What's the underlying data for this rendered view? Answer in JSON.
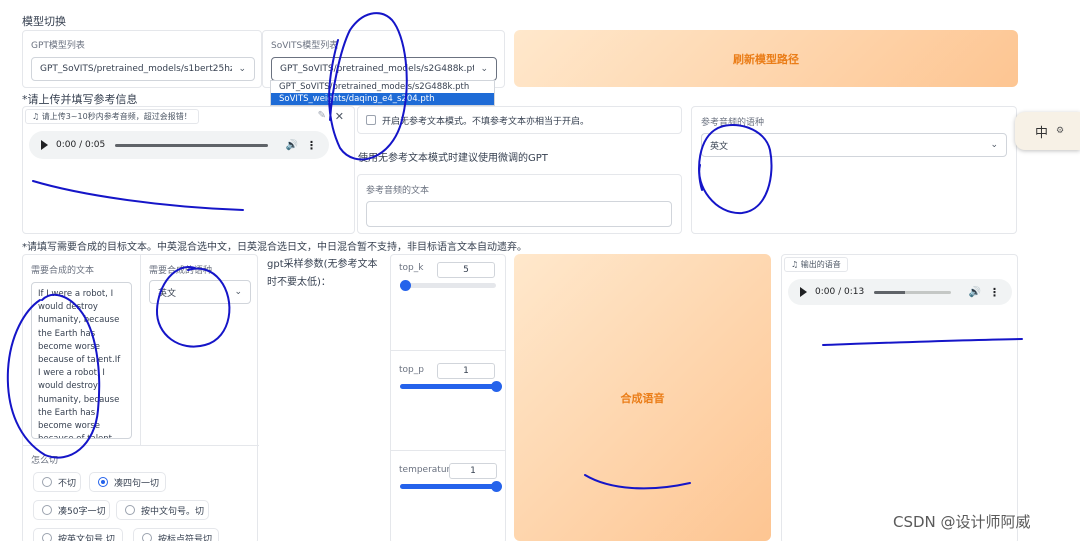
{
  "model_switch": {
    "title": "模型切换",
    "gpt_label": "GPT模型列表",
    "gpt_value": "GPT_SoVITS/pretrained_models/s1bert25hz-2kh",
    "sovits_label": "SoVITS模型列表",
    "sovits_value": "GPT_SoVITS/pretrained_models/s2G488k.pth",
    "sovits_options": [
      "GPT_SoVITS/pretrained_models/s2G488k.pth",
      "SoVITS_weights/daqing_e4_s204.pth"
    ],
    "refresh_label": "刷新模型路径"
  },
  "reference": {
    "title": "*请上传并填写参考信息",
    "upload_label": "请上传3~10秒内参考音频，超过会报错！",
    "audio_time": "0:00 / 0:05",
    "no_ref_checkbox": "开启无参考文本模式。不填参考文本亦相当于开启。",
    "no_ref_hint": "使用无参考文本模式时建议使用微调的GPT",
    "ref_text_label": "参考音频的文本",
    "ref_text_value": "",
    "ref_lang_label": "参考音频的语种",
    "ref_lang_value": "英文"
  },
  "synthesis": {
    "title": "*请填写需要合成的目标文本。中英混合选中文，日英混合选日文，中日混合暂不支持，非目标语言文本自动遗弃。",
    "target_text_label": "需要合成的文本",
    "target_text_value": "If I were a robot, I would destroy humanity, because the Earth has become worse because of talent.If I were a robot, I would destroy humanity, because the Earth has become worse because of talent",
    "target_lang_label": "需要合成的语种",
    "target_lang_value": "英文",
    "gpt_params_label": "gpt采样参数(无参考文本时不要太低)：",
    "top_k_label": "top_k",
    "top_k_value": "5",
    "top_p_label": "top_p",
    "top_p_value": "1",
    "temperature_label": "temperature",
    "temperature_value": "1",
    "top_k_fraction": 0.05,
    "top_p_fraction": 1.0,
    "temperature_fraction": 1.0,
    "synthesize_label": "合成语音",
    "output_label": "输出的语音",
    "output_time": "0:00 / 0:13",
    "cut_label": "怎么切",
    "cut_options": [
      "不切",
      "凑四句一切",
      "凑50字一切",
      "按中文句号。切",
      "按英文句号.切",
      "按标点符号切"
    ],
    "cut_selected": "凑四句一切"
  },
  "overlay": {
    "ime_text": "中",
    "watermark": "CSDN @设计师阿威"
  },
  "colors": {
    "accent": "#2563eb",
    "orange_text": "#ea7d18",
    "scribble": "#1515c8"
  }
}
